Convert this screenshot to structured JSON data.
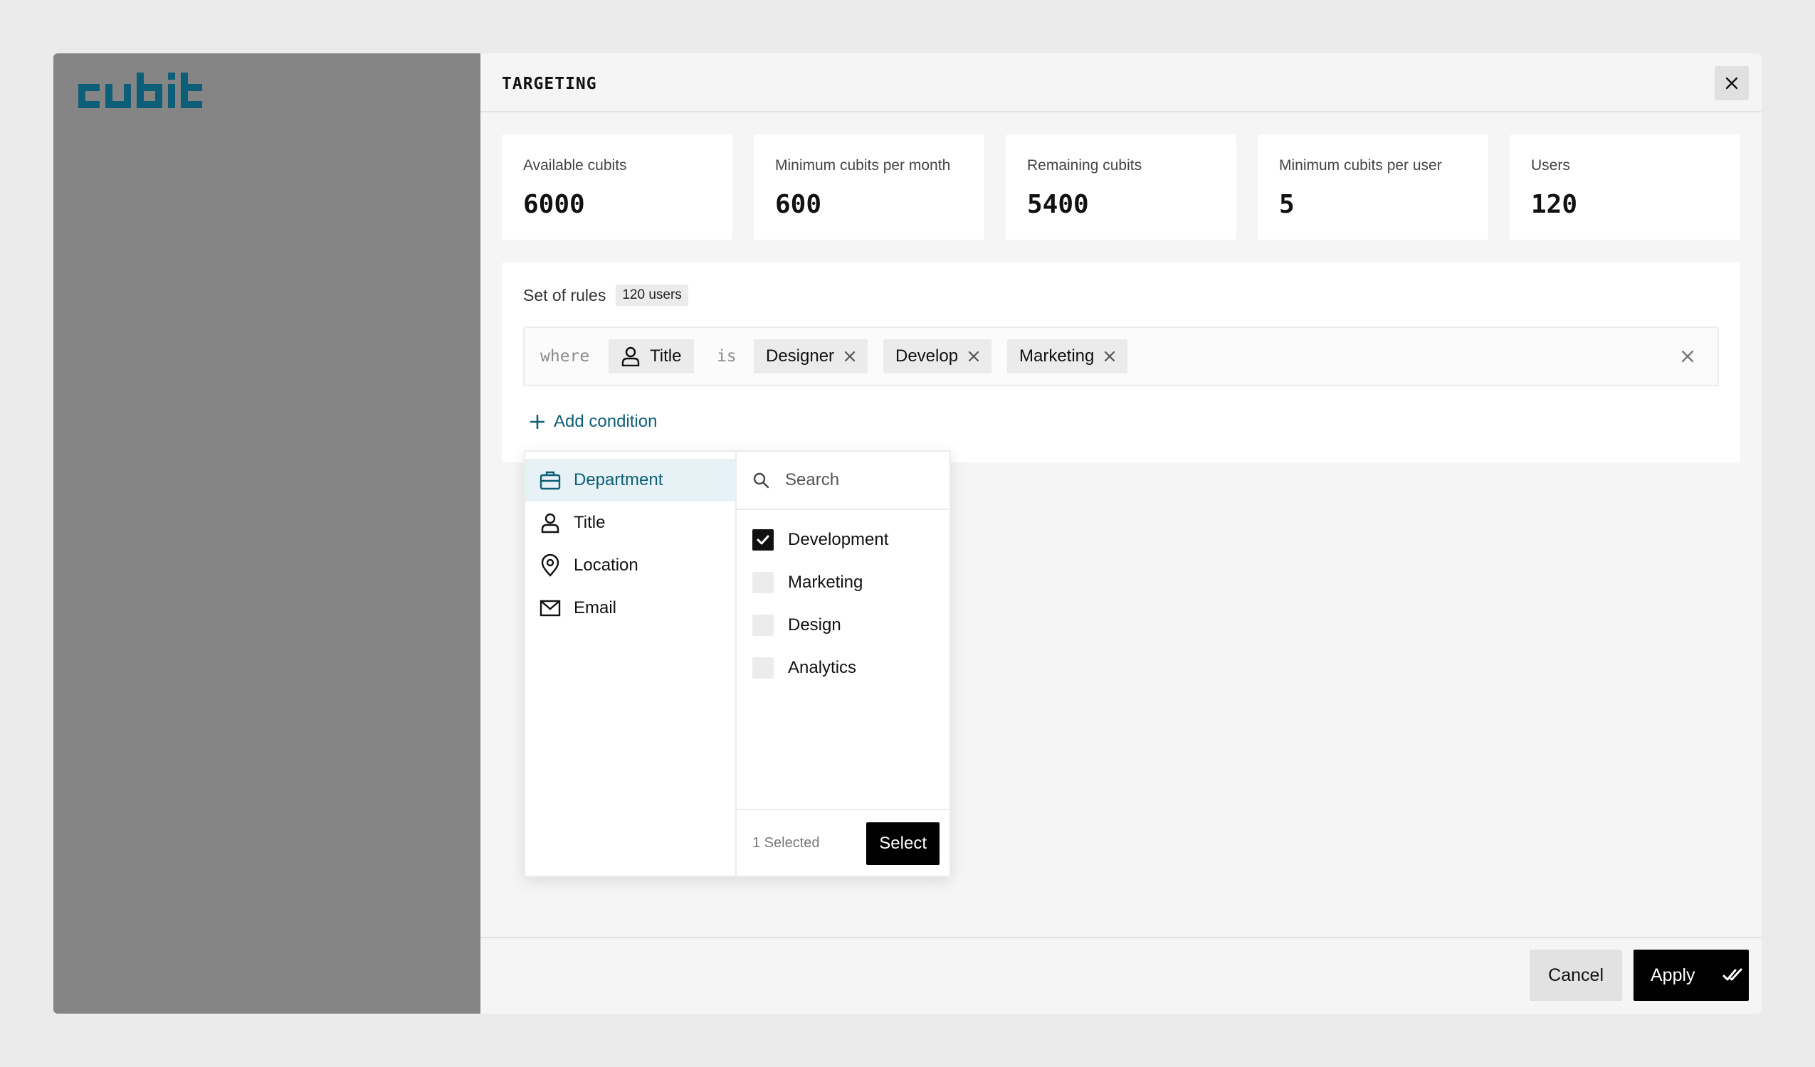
{
  "brand": {
    "name": "cubit",
    "color": "#0d5f78"
  },
  "header": {
    "title": "TARGETING",
    "close_icon": "close-icon"
  },
  "stats": [
    {
      "label": "Available cubits",
      "value": "6000"
    },
    {
      "label": "Minimum cubits per month",
      "value": "600"
    },
    {
      "label": "Remaining cubits",
      "value": "5400"
    },
    {
      "label": "Minimum cubits per user",
      "value": "5"
    },
    {
      "label": "Users",
      "value": "120"
    }
  ],
  "rules": {
    "title": "Set of rules",
    "count": "120 users",
    "condition": {
      "keyword_where": "where",
      "field": {
        "label": "Title",
        "icon": "person-icon"
      },
      "operator": "is",
      "values": [
        "Designer",
        "Develop",
        "Marketing"
      ]
    },
    "add_condition": "Add condition"
  },
  "dropdown": {
    "categories": [
      {
        "label": "Department",
        "icon": "briefcase-icon",
        "active": true
      },
      {
        "label": "Title",
        "icon": "person-icon",
        "active": false
      },
      {
        "label": "Location",
        "icon": "location-pin-icon",
        "active": false
      },
      {
        "label": "Email",
        "icon": "envelope-icon",
        "active": false
      }
    ],
    "search_placeholder": "Search",
    "options": [
      {
        "label": "Development",
        "checked": true
      },
      {
        "label": "Marketing",
        "checked": false
      },
      {
        "label": "Design",
        "checked": false
      },
      {
        "label": "Analytics",
        "checked": false
      }
    ],
    "selected_count": "1 Selected",
    "select_label": "Select"
  },
  "footer": {
    "cancel_label": "Cancel",
    "apply_label": "Apply",
    "apply_icon": "double-check-icon"
  },
  "colors": {
    "accent": "#0d5f78",
    "sidebar": "#858585",
    "background": "#ebebeb"
  }
}
